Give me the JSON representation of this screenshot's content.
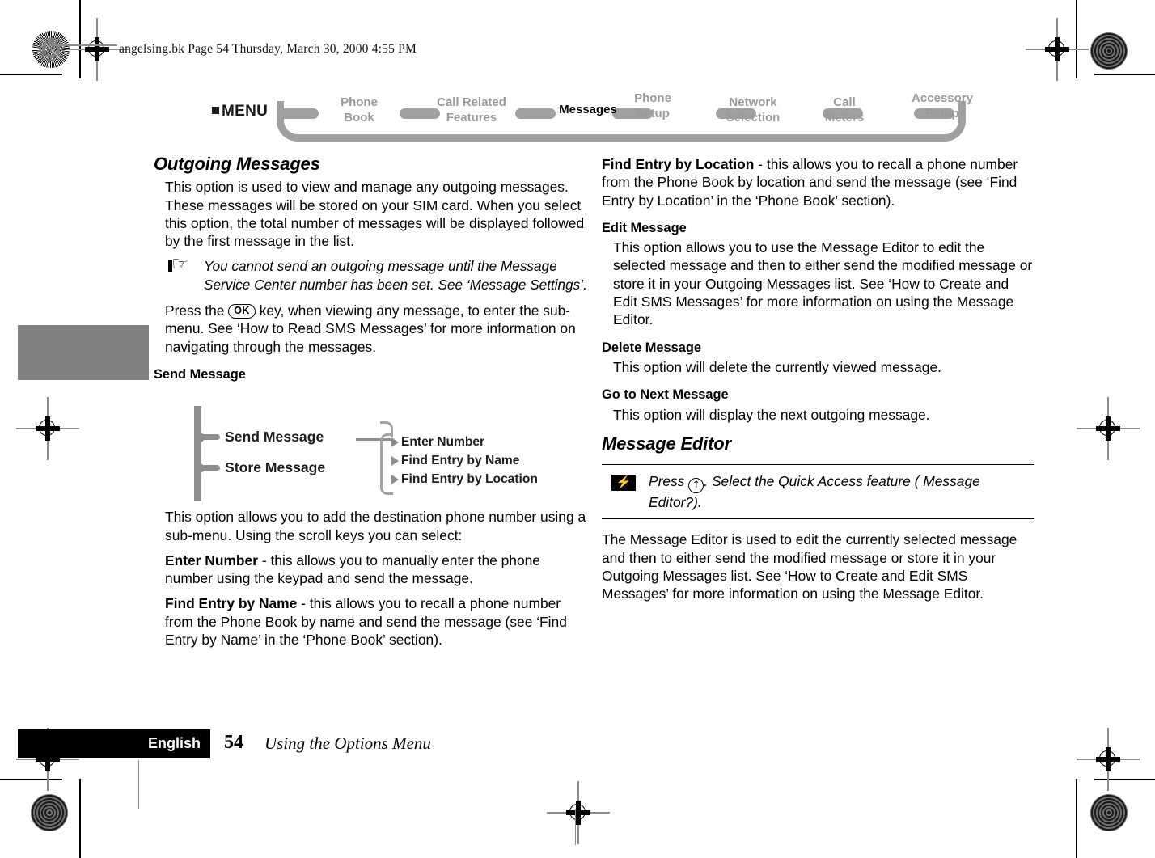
{
  "page": {
    "doc_header": "angelsing.bk  Page 54  Thursday, March 30, 2000  4:55 PM"
  },
  "menubar": {
    "menu_label": "MENU",
    "items": [
      {
        "line1": "Phone",
        "line2": "Book",
        "active": false
      },
      {
        "line1": "Call Related",
        "line2": "Features",
        "active": false
      },
      {
        "line1": "Messages",
        "line2": "",
        "active": true
      },
      {
        "line1": "Phone",
        "line2": "Setup",
        "active": false
      },
      {
        "line1": "Network",
        "line2": "Selection",
        "active": false
      },
      {
        "line1": "Call",
        "line2": "Meters",
        "active": false
      },
      {
        "line1": "Accessory",
        "line2": "Setup",
        "active": false
      }
    ]
  },
  "left_column": {
    "section_title": "Outgoing Messages",
    "intro": "This option is used to view and manage any outgoing messages. These messages will be stored on your SIM card. When you select this option, the total number of messages will be displayed followed by the first message in the list.",
    "note_icon": "pointing-hand-icon",
    "note": "You cannot send an outgoing message until the Message Service Center number has been set. See ‘Message Settings’.",
    "press_ok_before": "Press the ",
    "ok_key_label": "OK",
    "press_ok_after": " key, when viewing any message, to enter the sub-menu. See ‘How to Read SMS Messages’ for more information on navigating through the messages.",
    "send_message_heading": "Send Message",
    "after_diagram": "This option allows you to add the destination phone number using a sub-menu. Using the scroll keys you can select:",
    "terms": [
      {
        "term": "Enter Number",
        "desc": " - this allows you to manually enter the phone number using the keypad and send the message."
      },
      {
        "term": "Find Entry by Name",
        "desc": " - this allows you to recall a phone number from the Phone Book by name and send the message (see ‘Find Entry by Name’ in the ‘Phone Book’ section)."
      }
    ]
  },
  "diagram": {
    "level1": [
      "Send Message",
      "Store Message"
    ],
    "level2": [
      "Enter Number",
      "Find Entry by Name",
      "Find Entry by Location"
    ]
  },
  "right_column": {
    "terms": [
      {
        "term": "Find Entry by Location",
        "desc": " - this allows you to recall a phone number from the Phone Book by location and send the message (see ‘Find Entry by Location’ in the ‘Phone Book’ section)."
      }
    ],
    "subsections": [
      {
        "heading": "Edit Message",
        "body": "This option allows you to use the Message Editor to edit the selected message and then to either send the modified message or store it in your Outgoing Messages list. See ‘How to Create and Edit SMS Messages’ for more information on using the Message Editor."
      },
      {
        "heading": "Delete Message",
        "body": "This option will delete the currently viewed message."
      },
      {
        "heading": "Go to Next Message",
        "body": "This option will display the next outgoing message."
      }
    ],
    "section_title": "Message Editor",
    "callout": {
      "icon": "lightning-bolt-icon",
      "before_key": "Press ",
      "key_label": "↑",
      "after_key": ". Select the Quick Access feature ( Message Editor?)."
    },
    "closing": "The Message Editor is used to edit the currently selected message and then to either send the modified message or store it in your Outgoing Messages list. See ‘How to Create and Edit SMS Messages’ for more information on using the Message Editor."
  },
  "footer": {
    "language": "English",
    "page_number": "54",
    "section": "Using the Options Menu"
  }
}
